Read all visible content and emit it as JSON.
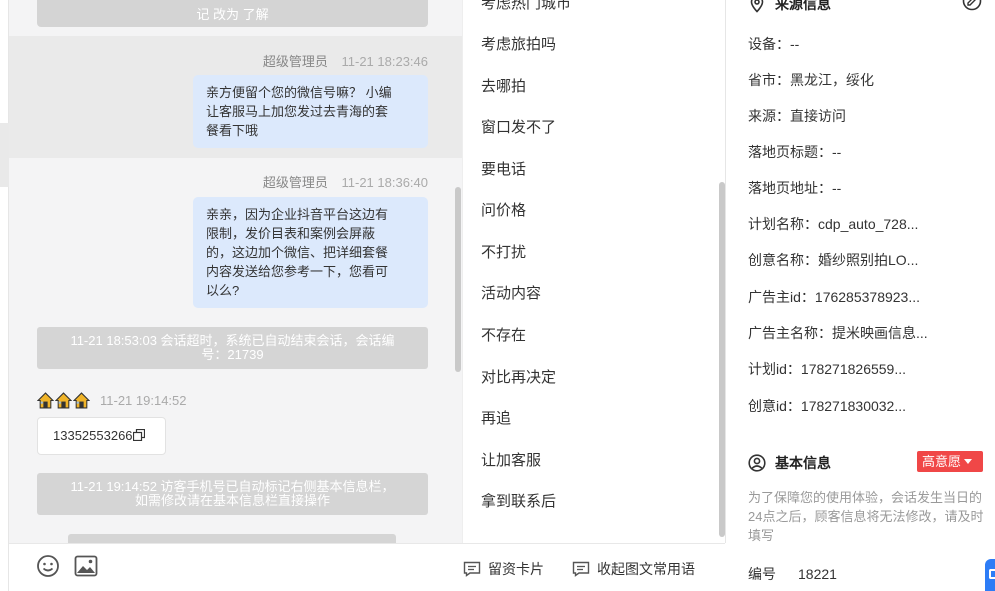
{
  "chat": {
    "top_partial": "记  改为 了解",
    "messages": [
      {
        "sender": "超级管理员",
        "time": "11-21 18:23:46",
        "lines": [
          "亲方便留个您的微信号嘛？ 小编",
          "让客服马上加您发过去青海的套",
          "餐看下哦"
        ]
      },
      {
        "sender": "超级管理员",
        "time": "11-21 18:36:40",
        "lines": [
          "亲亲，因为企业抖音平台这边有",
          "限制，发价目表和案例会屏蔽",
          "的，这边加个微信、把详细套餐",
          "内容发送给您参考一下，您看可",
          "以么?"
        ]
      }
    ],
    "system_1": {
      "line1": "11-21 18:53:03 会话超时，系统已自动结束会话，会话编",
      "line2": "号：21739"
    },
    "visitor": {
      "time": "11-21 19:14:52",
      "phone": "13352553266"
    },
    "system_2": {
      "line1": "11-21 19:14:52 访客手机号已自动标记右侧基本信息栏，",
      "line2": "如需修改请在基本信息栏直接操作"
    },
    "toolbar": {
      "card_label": "留资卡片",
      "collect_label": "收起图文常用语"
    },
    "icons": [
      "emoji-icon",
      "image-icon",
      "house-icon",
      "copy-icon",
      "message-card-icon"
    ]
  },
  "quick_replies": {
    "partial_top": "考虑热门城市",
    "items": [
      "考虑旅拍吗",
      "去哪拍",
      "窗口发不了",
      "要电话",
      "问价格",
      "不打扰",
      "活动内容",
      "不存在",
      "对比再决定",
      "再追",
      "让加客服",
      "拿到联系后"
    ]
  },
  "info": {
    "source_title": "来源信息",
    "source_rows": [
      {
        "label": "设备：",
        "value": "--"
      },
      {
        "label": "省市：",
        "value": "黑龙江，绥化"
      },
      {
        "label": "来源：",
        "value": "直接访问"
      },
      {
        "label": "落地页标题：",
        "value": "--"
      },
      {
        "label": "落地页地址：",
        "value": "--"
      },
      {
        "label": "计划名称：",
        "value": "cdp_auto_728..."
      },
      {
        "label": "创意名称：",
        "value": "婚纱照别拍LO..."
      },
      {
        "label": "广告主id：",
        "value": "176285378923..."
      },
      {
        "label": "广告主名称：",
        "value": "提米映画信息..."
      },
      {
        "label": "计划id：",
        "value": "178271826559..."
      },
      {
        "label": "创意id：",
        "value": "178271830032..."
      }
    ],
    "basic_title": "基本信息",
    "intent_tag": "高意愿",
    "hint": "为了保障您的使用体验，会话发生当日的24点之后，顾客信息将无法修改，请及时填写",
    "number_label": "编号",
    "number_value": "18221",
    "colors": {
      "accent_blue": "#2d7cf6",
      "tag_red": "#f04747",
      "bubble_blue": "#dce9fc"
    }
  }
}
